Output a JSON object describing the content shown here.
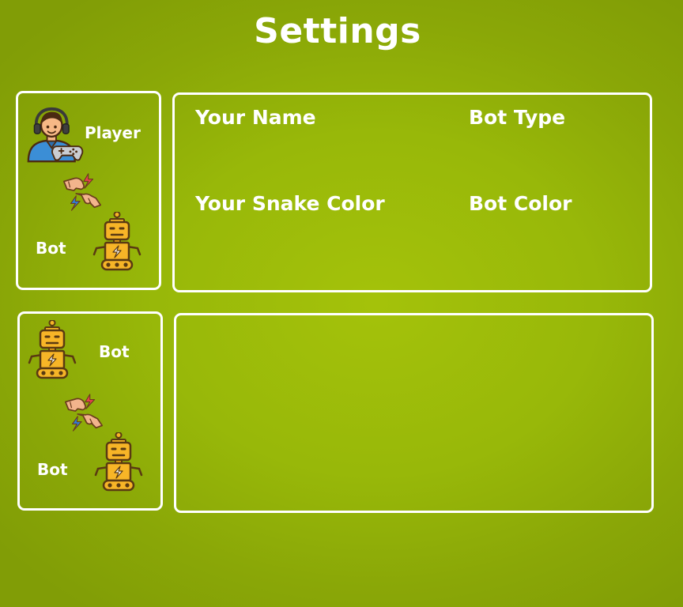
{
  "page": {
    "title": "Settings"
  },
  "modes": [
    {
      "top_label": "Player",
      "bottom_label": "Bot",
      "top_icon": "gamer-with-controller-icon",
      "versus_icon": "fist-bump-icon",
      "bottom_icon": "robot-icon"
    },
    {
      "top_label": "Bot",
      "bottom_label": "Bot",
      "top_icon": "robot-icon",
      "versus_icon": "fist-bump-icon",
      "bottom_icon": "robot-icon"
    }
  ],
  "settings": {
    "name_label": "Your Name",
    "bot_type_label": "Bot Type",
    "snake_color_label": "Your Snake Color",
    "bot_color_label": "Bot Color"
  },
  "colors": {
    "background": "#98b809",
    "text": "#ffffff",
    "robot_body": "#f7b527",
    "robot_outline": "#5a3a12",
    "player_shirt": "#3b8ed6"
  }
}
